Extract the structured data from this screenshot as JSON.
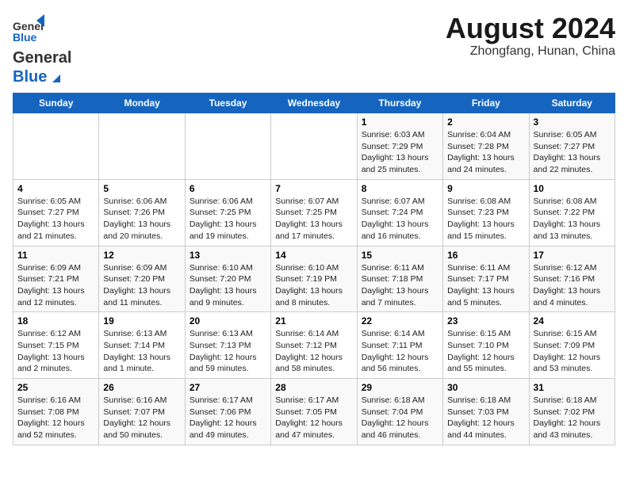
{
  "header": {
    "logo_general": "General",
    "logo_blue": "Blue",
    "month_title": "August 2024",
    "location": "Zhongfang, Hunan, China"
  },
  "days_of_week": [
    "Sunday",
    "Monday",
    "Tuesday",
    "Wednesday",
    "Thursday",
    "Friday",
    "Saturday"
  ],
  "weeks": [
    [
      {
        "day": "",
        "info": ""
      },
      {
        "day": "",
        "info": ""
      },
      {
        "day": "",
        "info": ""
      },
      {
        "day": "",
        "info": ""
      },
      {
        "day": "1",
        "info": "Sunrise: 6:03 AM\nSunset: 7:29 PM\nDaylight: 13 hours and 25 minutes."
      },
      {
        "day": "2",
        "info": "Sunrise: 6:04 AM\nSunset: 7:28 PM\nDaylight: 13 hours and 24 minutes."
      },
      {
        "day": "3",
        "info": "Sunrise: 6:05 AM\nSunset: 7:27 PM\nDaylight: 13 hours and 22 minutes."
      }
    ],
    [
      {
        "day": "4",
        "info": "Sunrise: 6:05 AM\nSunset: 7:27 PM\nDaylight: 13 hours and 21 minutes."
      },
      {
        "day": "5",
        "info": "Sunrise: 6:06 AM\nSunset: 7:26 PM\nDaylight: 13 hours and 20 minutes."
      },
      {
        "day": "6",
        "info": "Sunrise: 6:06 AM\nSunset: 7:25 PM\nDaylight: 13 hours and 19 minutes."
      },
      {
        "day": "7",
        "info": "Sunrise: 6:07 AM\nSunset: 7:25 PM\nDaylight: 13 hours and 17 minutes."
      },
      {
        "day": "8",
        "info": "Sunrise: 6:07 AM\nSunset: 7:24 PM\nDaylight: 13 hours and 16 minutes."
      },
      {
        "day": "9",
        "info": "Sunrise: 6:08 AM\nSunset: 7:23 PM\nDaylight: 13 hours and 15 minutes."
      },
      {
        "day": "10",
        "info": "Sunrise: 6:08 AM\nSunset: 7:22 PM\nDaylight: 13 hours and 13 minutes."
      }
    ],
    [
      {
        "day": "11",
        "info": "Sunrise: 6:09 AM\nSunset: 7:21 PM\nDaylight: 13 hours and 12 minutes."
      },
      {
        "day": "12",
        "info": "Sunrise: 6:09 AM\nSunset: 7:20 PM\nDaylight: 13 hours and 11 minutes."
      },
      {
        "day": "13",
        "info": "Sunrise: 6:10 AM\nSunset: 7:20 PM\nDaylight: 13 hours and 9 minutes."
      },
      {
        "day": "14",
        "info": "Sunrise: 6:10 AM\nSunset: 7:19 PM\nDaylight: 13 hours and 8 minutes."
      },
      {
        "day": "15",
        "info": "Sunrise: 6:11 AM\nSunset: 7:18 PM\nDaylight: 13 hours and 7 minutes."
      },
      {
        "day": "16",
        "info": "Sunrise: 6:11 AM\nSunset: 7:17 PM\nDaylight: 13 hours and 5 minutes."
      },
      {
        "day": "17",
        "info": "Sunrise: 6:12 AM\nSunset: 7:16 PM\nDaylight: 13 hours and 4 minutes."
      }
    ],
    [
      {
        "day": "18",
        "info": "Sunrise: 6:12 AM\nSunset: 7:15 PM\nDaylight: 13 hours and 2 minutes."
      },
      {
        "day": "19",
        "info": "Sunrise: 6:13 AM\nSunset: 7:14 PM\nDaylight: 13 hours and 1 minute."
      },
      {
        "day": "20",
        "info": "Sunrise: 6:13 AM\nSunset: 7:13 PM\nDaylight: 12 hours and 59 minutes."
      },
      {
        "day": "21",
        "info": "Sunrise: 6:14 AM\nSunset: 7:12 PM\nDaylight: 12 hours and 58 minutes."
      },
      {
        "day": "22",
        "info": "Sunrise: 6:14 AM\nSunset: 7:11 PM\nDaylight: 12 hours and 56 minutes."
      },
      {
        "day": "23",
        "info": "Sunrise: 6:15 AM\nSunset: 7:10 PM\nDaylight: 12 hours and 55 minutes."
      },
      {
        "day": "24",
        "info": "Sunrise: 6:15 AM\nSunset: 7:09 PM\nDaylight: 12 hours and 53 minutes."
      }
    ],
    [
      {
        "day": "25",
        "info": "Sunrise: 6:16 AM\nSunset: 7:08 PM\nDaylight: 12 hours and 52 minutes."
      },
      {
        "day": "26",
        "info": "Sunrise: 6:16 AM\nSunset: 7:07 PM\nDaylight: 12 hours and 50 minutes."
      },
      {
        "day": "27",
        "info": "Sunrise: 6:17 AM\nSunset: 7:06 PM\nDaylight: 12 hours and 49 minutes."
      },
      {
        "day": "28",
        "info": "Sunrise: 6:17 AM\nSunset: 7:05 PM\nDaylight: 12 hours and 47 minutes."
      },
      {
        "day": "29",
        "info": "Sunrise: 6:18 AM\nSunset: 7:04 PM\nDaylight: 12 hours and 46 minutes."
      },
      {
        "day": "30",
        "info": "Sunrise: 6:18 AM\nSunset: 7:03 PM\nDaylight: 12 hours and 44 minutes."
      },
      {
        "day": "31",
        "info": "Sunrise: 6:18 AM\nSunset: 7:02 PM\nDaylight: 12 hours and 43 minutes."
      }
    ]
  ]
}
